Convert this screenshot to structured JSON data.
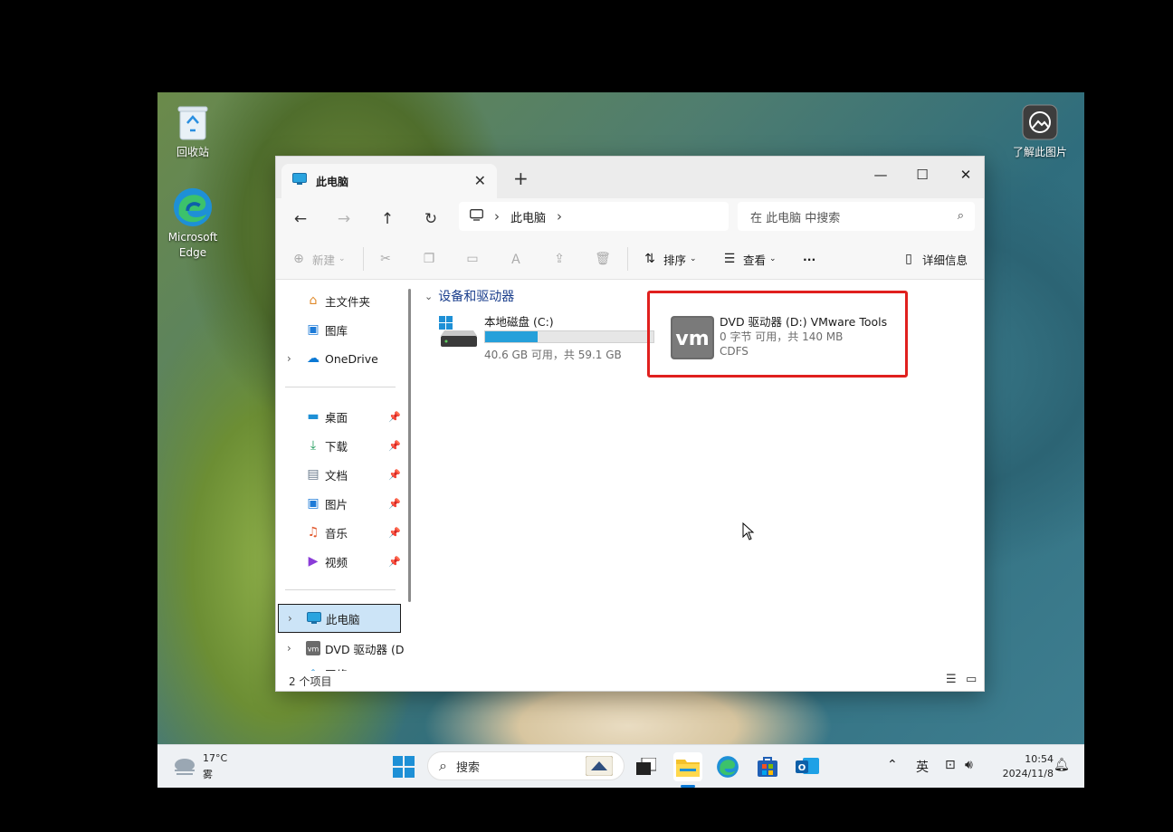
{
  "desktop": {
    "icons": [
      {
        "label": "回收站",
        "icon": "recycle-bin-icon"
      },
      {
        "label": "Microsoft Edge",
        "icon": "edge-icon"
      },
      {
        "label": "了解此图片",
        "icon": "learn-image-icon"
      }
    ]
  },
  "window": {
    "tab_title": "此电脑",
    "new_tab": "+",
    "address": {
      "location": "此电脑"
    },
    "search_placeholder": "在 此电脑 中搜索",
    "toolbar": {
      "new_label": "新建",
      "sort_label": "排序",
      "view_label": "查看",
      "more_label": "···",
      "details_label": "详细信息"
    },
    "nav": {
      "items": [
        {
          "label": "主文件夹",
          "icon": "home-icon"
        },
        {
          "label": "图库",
          "icon": "gallery-icon"
        },
        {
          "label": "OneDrive",
          "icon": "onedrive-icon"
        },
        {
          "label": "桌面",
          "icon": "desktop-icon"
        },
        {
          "label": "下载",
          "icon": "download-icon"
        },
        {
          "label": "文档",
          "icon": "documents-icon"
        },
        {
          "label": "图片",
          "icon": "pictures-icon"
        },
        {
          "label": "音乐",
          "icon": "music-icon"
        },
        {
          "label": "视频",
          "icon": "videos-icon"
        },
        {
          "label": "此电脑",
          "icon": "this-pc-icon"
        },
        {
          "label": "DVD 驱动器 (D",
          "icon": "vmware-icon"
        },
        {
          "label": "网络",
          "icon": "network-icon"
        }
      ]
    },
    "content": {
      "group_title": "设备和驱动器",
      "drives": [
        {
          "name": "本地磁盘 (C:)",
          "detail": "40.6 GB 可用，共 59.1 GB",
          "used_fraction": 0.313
        },
        {
          "name": "DVD 驱动器 (D:) VMware Tools",
          "detail": "0 字节 可用，共 140 MB",
          "filesystem": "CDFS"
        }
      ]
    },
    "status": "2 个项目"
  },
  "taskbar": {
    "weather": {
      "temp": "17°C",
      "condition": "雾"
    },
    "search_label": "搜索",
    "ime": "英",
    "time": "10:54",
    "date": "2024/11/8"
  },
  "colors": {
    "accent": "#0a78d4",
    "highlight_box": "#e0201e",
    "selection": "#cce4f7"
  }
}
